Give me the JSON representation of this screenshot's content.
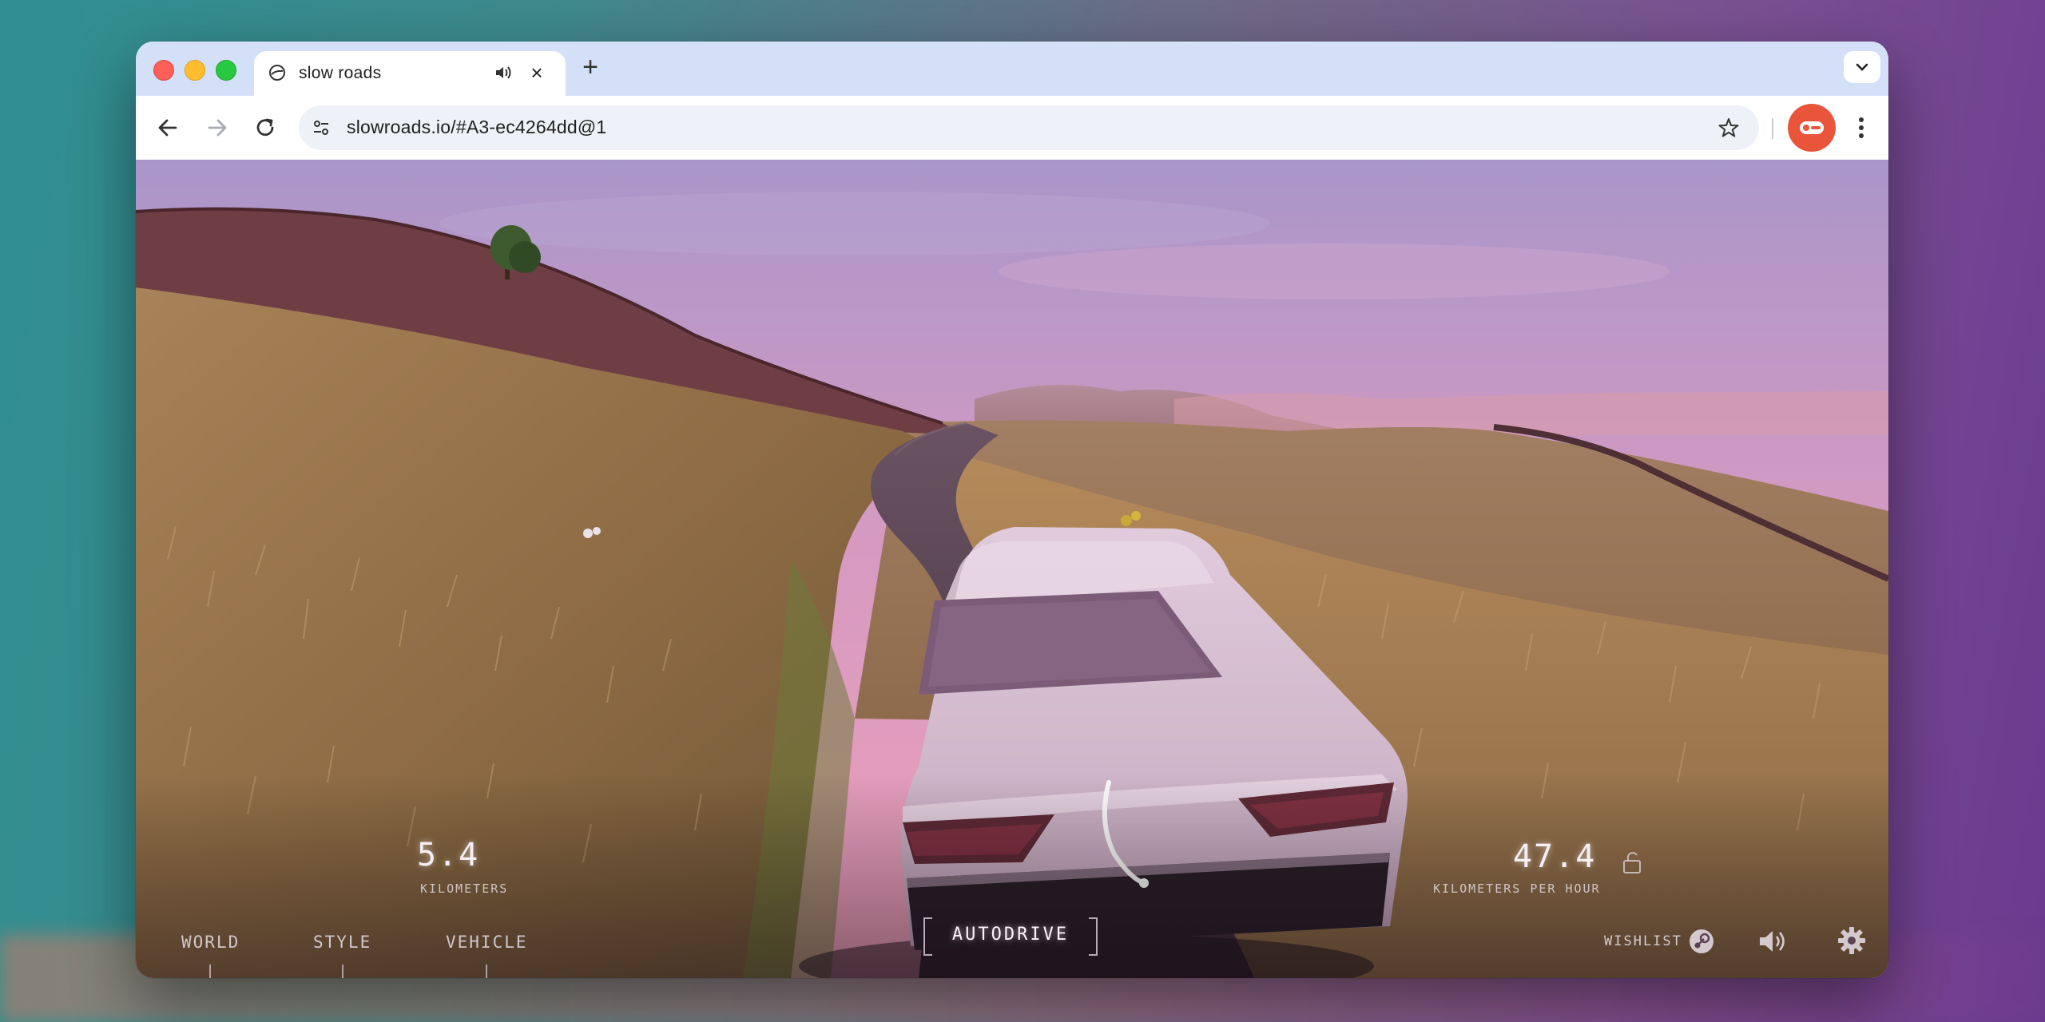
{
  "browser": {
    "tab": {
      "title": "slow roads",
      "favicon": "slow-roads-favicon",
      "audio_icon": "speaker-icon",
      "close_icon": "close-icon"
    },
    "new_tab_icon": "plus-icon",
    "tab_search_icon": "chevron-down-icon",
    "nav": {
      "back_icon": "back-arrow-icon",
      "forward_icon": "forward-arrow-icon",
      "reload_icon": "reload-icon"
    },
    "omnibox": {
      "url": "slowroads.io/#A3-ec4264dd@1",
      "site_info_icon": "tune-icon",
      "bookmark_icon": "star-icon"
    },
    "profile_icon": "profile-avatar-icon",
    "menu_icon": "more-vert-icon"
  },
  "hud": {
    "distance": {
      "value": "5.4",
      "label": "KILOMETERS"
    },
    "speed": {
      "value": "47.4",
      "label": "KILOMETERS PER HOUR",
      "lock_icon": "unlock-icon"
    },
    "menu": {
      "world": "WORLD",
      "style": "STYLE",
      "vehicle": "VEHICLE"
    },
    "autodrive": "AUTODRIVE",
    "wishlist": "WISHLIST",
    "steam_icon": "steam-icon",
    "volume_icon": "volume-icon",
    "settings_icon": "gear-icon"
  },
  "colors": {
    "tab_strip": "#d4e0f8",
    "profile": "#e8553a",
    "sky_top": "#a996c9",
    "sky_bottom": "#e99ab8",
    "grass": "#9a7548",
    "road": "#4f3b48",
    "car": "#d9c2d4"
  }
}
